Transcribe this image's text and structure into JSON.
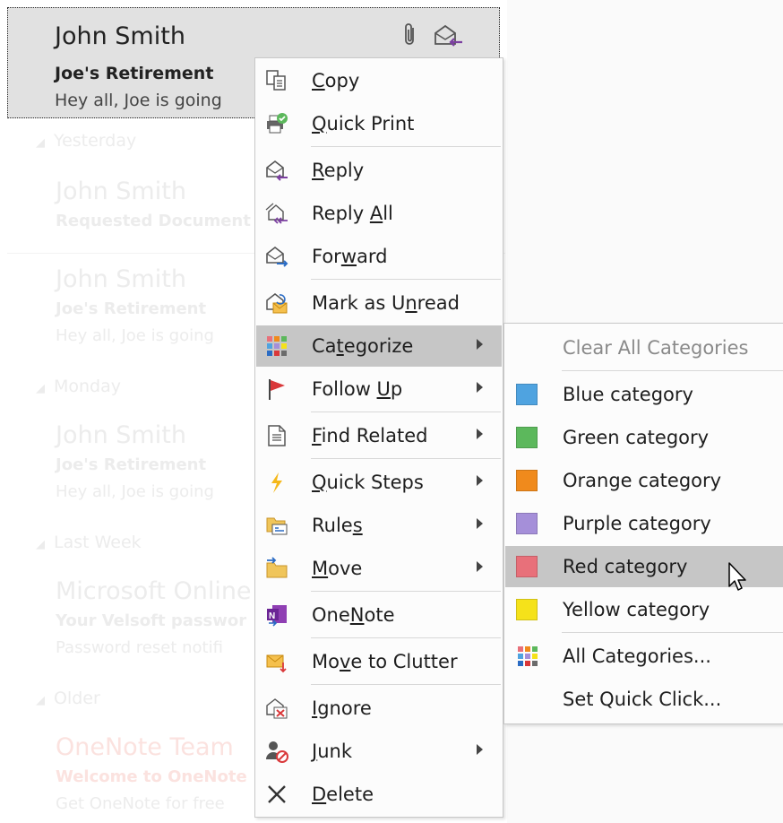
{
  "mail_list": {
    "selected": {
      "sender": "John Smith",
      "subject": "Joe's Retirement",
      "preview": "Hey all,   Joe is going"
    },
    "groups": [
      {
        "header": "Yesterday",
        "messages": [
          {
            "sender": "John Smith",
            "subject": "Requested Document",
            "preview": ""
          },
          {
            "sender": "John Smith",
            "subject": "Joe's Retirement",
            "preview": "Hey all,   Joe is going"
          }
        ]
      },
      {
        "header": "Monday",
        "messages": [
          {
            "sender": "John Smith",
            "subject": "Joe's Retirement",
            "preview": "Hey all,   Joe is going"
          }
        ]
      },
      {
        "header": "Last Week",
        "messages": [
          {
            "sender": "Microsoft Online",
            "subject": "Your Velsoft passwor",
            "preview": "Password reset notifi"
          }
        ]
      },
      {
        "header": "Older",
        "messages": [
          {
            "sender": "OneNote Team",
            "subject": "Welcome to OneNote",
            "preview": "Get OneNote for free"
          }
        ]
      }
    ]
  },
  "context_menu": {
    "items": [
      {
        "label": "Copy",
        "u": "C"
      },
      {
        "label": "Quick Print",
        "u": "Q"
      },
      {
        "label": "Reply",
        "u": "R"
      },
      {
        "label": "Reply All",
        "u": "A"
      },
      {
        "label": "Forward",
        "u": "w"
      },
      {
        "label": "Mark as Unread",
        "u": "n"
      },
      {
        "label": "Categorize",
        "u": "t"
      },
      {
        "label": "Follow Up",
        "u": "U"
      },
      {
        "label": "Find Related",
        "u": "F"
      },
      {
        "label": "Quick Steps",
        "u": "Q"
      },
      {
        "label": "Rules",
        "u": "s"
      },
      {
        "label": "Move",
        "u": "M"
      },
      {
        "label": "OneNote",
        "u": "N"
      },
      {
        "label": "Move to Clutter",
        "u": "v"
      },
      {
        "label": "Ignore",
        "u": "I"
      },
      {
        "label": "Junk",
        "u": "J"
      },
      {
        "label": "Delete",
        "u": "D"
      }
    ]
  },
  "submenu": {
    "clear_all": "Clear All Categories",
    "categories": [
      {
        "label": "Blue category",
        "color": "#4fa3e0"
      },
      {
        "label": "Green category",
        "color": "#5cb85c"
      },
      {
        "label": "Orange category",
        "color": "#f08a1c"
      },
      {
        "label": "Purple category",
        "color": "#a58fd9"
      },
      {
        "label": "Red category",
        "color": "#e8707a"
      },
      {
        "label": "Yellow category",
        "color": "#f5e21a"
      }
    ],
    "all_categories": "All Categories...",
    "set_quick_click": "Set Quick Click..."
  },
  "colors": {
    "highlight": "#c6c6c6",
    "reply_purple": "#7b3fa0",
    "flag_red": "#d9383a"
  }
}
